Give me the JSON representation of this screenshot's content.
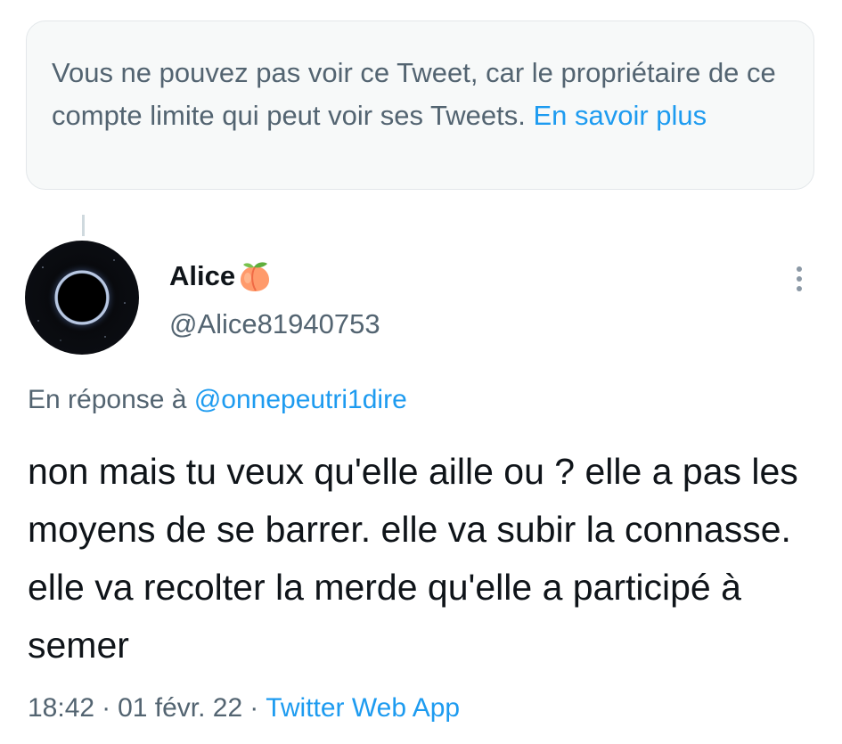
{
  "notice": {
    "text": "Vous ne pouvez pas voir ce Tweet, car le propriétaire de ce compte limite qui peut voir ses Tweets.",
    "link_label": "En savoir plus"
  },
  "tweet": {
    "display_name": "Alice",
    "emoji_icon": "peach-emoji",
    "handle": "@Alice81940753",
    "reply_prefix": "En réponse à",
    "reply_to": "@onnepeutri1dire",
    "text": "non mais tu veux qu'elle aille ou ? elle a pas les moyens de se barrer. elle va subir la connasse. elle va recolter la merde qu'elle a participé à semer",
    "time": "18:42",
    "date": "01 févr. 22",
    "source": "Twitter Web App"
  },
  "colors": {
    "link": "#1d9bf0",
    "secondary_text": "#536471",
    "primary_text": "#0f1419",
    "notice_bg": "#f7f9f9"
  }
}
